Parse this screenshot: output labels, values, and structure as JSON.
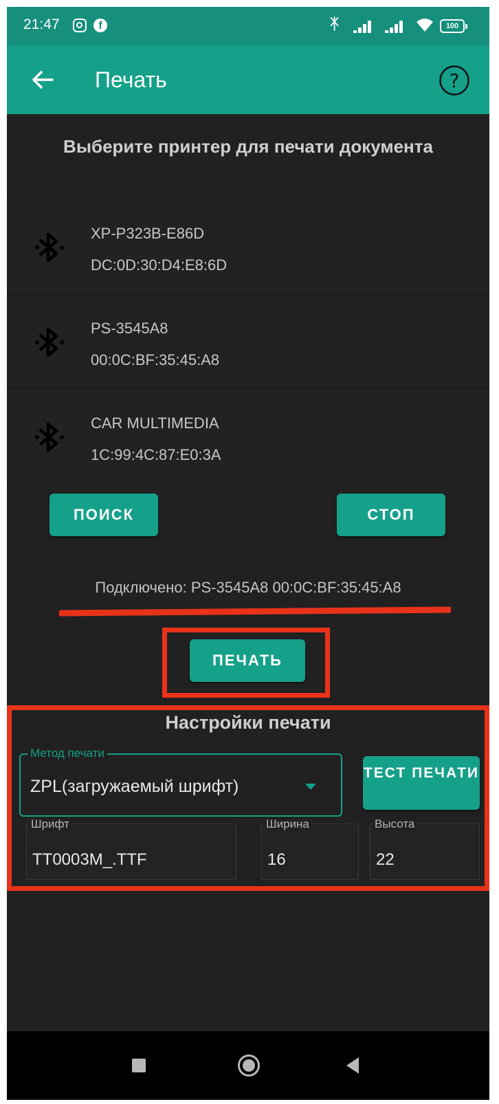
{
  "status_bar": {
    "time": "21:47",
    "battery": "100",
    "icons": [
      "instagram-icon",
      "facebook-icon",
      "bluetooth-icon",
      "signal-icon",
      "signal-icon",
      "wifi-icon",
      "battery-icon"
    ]
  },
  "toolbar": {
    "title": "Печать",
    "back_icon": "arrow-left-icon",
    "help_icon": "help-icon"
  },
  "instruction": "Выберите принтер для печати документа",
  "devices": [
    {
      "name": "XP-P323B-E86D",
      "address": "DC:0D:30:D4:E8:6D"
    },
    {
      "name": "PS-3545A8",
      "address": "00:0C:BF:35:45:A8"
    },
    {
      "name": "CAR MULTIMEDIA",
      "address": "1C:99:4C:87:E0:3A"
    }
  ],
  "buttons": {
    "search": "ПОИСК",
    "stop": "СТОП",
    "print": "ПЕЧАТЬ",
    "test_print": "ТЕСТ ПЕЧАТИ"
  },
  "connected_status": "Подключено: PS-3545A8 00:0C:BF:35:45:A8",
  "settings": {
    "title": "Настройки печати",
    "method_label": "Метод печати",
    "method_value": "ZPL(загружаемый шрифт)",
    "font_label": "Шрифт",
    "font_value": "TT0003M_.TTF",
    "width_label": "Ширина",
    "width_value": "16",
    "height_label": "Высота",
    "height_value": "22"
  },
  "colors": {
    "accent": "#15a089",
    "status_bar": "#168f7d",
    "background": "#212121",
    "annotation": "#e8331a"
  }
}
